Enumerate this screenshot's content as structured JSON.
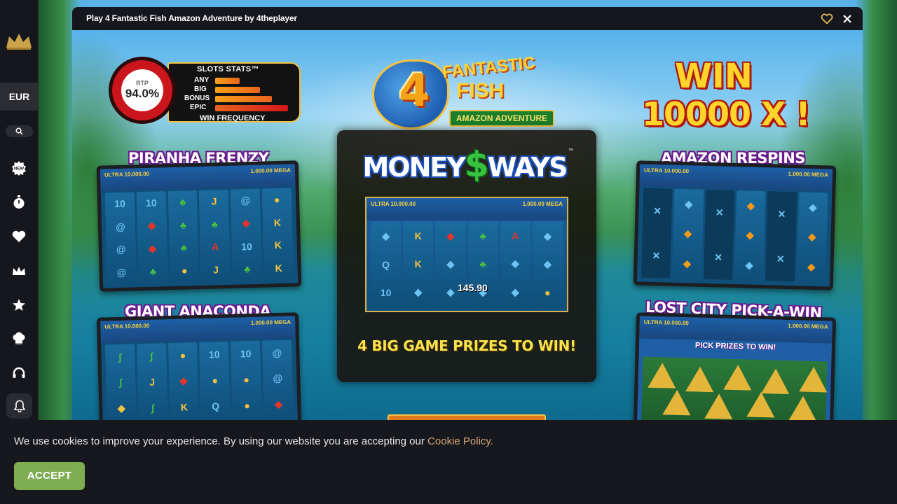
{
  "modal": {
    "title": "Play 4 Fantastic Fish Amazon Adventure by 4theplayer"
  },
  "sidebar": {
    "currency": "EUR",
    "icons": [
      "crown-logo-icon",
      "search-icon",
      "new-badge-icon",
      "stopwatch-icon",
      "heart-icon",
      "crown-icon",
      "star-icon",
      "chef-hat-icon",
      "headset-icon",
      "bell-icon"
    ]
  },
  "game": {
    "rtp_label": "RTP",
    "rtp_value": "94.0%",
    "stats_title": "SLOTS STATS™",
    "stats_rows": [
      {
        "label": "ANY",
        "level": 0.3
      },
      {
        "label": "BIG",
        "level": 0.55
      },
      {
        "label": "BONUS",
        "level": 0.7
      },
      {
        "label": "EPIC",
        "level": 0.9
      }
    ],
    "stats_footer": "WIN FREQUENCY",
    "logo_number": "4",
    "logo_fantastic": "FANTASTIC",
    "logo_fish": "FISH",
    "logo_subtitle": "AMAZON ADVENTURE",
    "win_word": "WIN",
    "win_amount": "10000 X !",
    "features": {
      "piranha": "PIRANHA FRENZY",
      "anaconda": "GIANT ANACONDA",
      "respins": "AMAZON RESPINS",
      "lost_city": "LOST CITY PICK-A-WIN"
    },
    "money_ways_left": "MONEY",
    "money_ways_symbol": "$",
    "money_ways_right": "WAYS",
    "tm": "™",
    "center_win": "145.90",
    "prizes_text": "4 BIG GAME PRIZES TO WIN!",
    "pick_text": "PICK PRIZES TO WIN!",
    "shot_head_left": "ULTRA 10.000.00",
    "shot_head_right": "1.000.00 MEGA"
  },
  "cookie": {
    "text": "We use cookies to improve your experience. By using our website you are accepting our ",
    "link": "Cookie Policy.",
    "accept": "ACCEPT"
  },
  "colors": {
    "accent_green": "#7fad52",
    "link": "#d5a777",
    "sidebar_bg": "#16171c"
  }
}
